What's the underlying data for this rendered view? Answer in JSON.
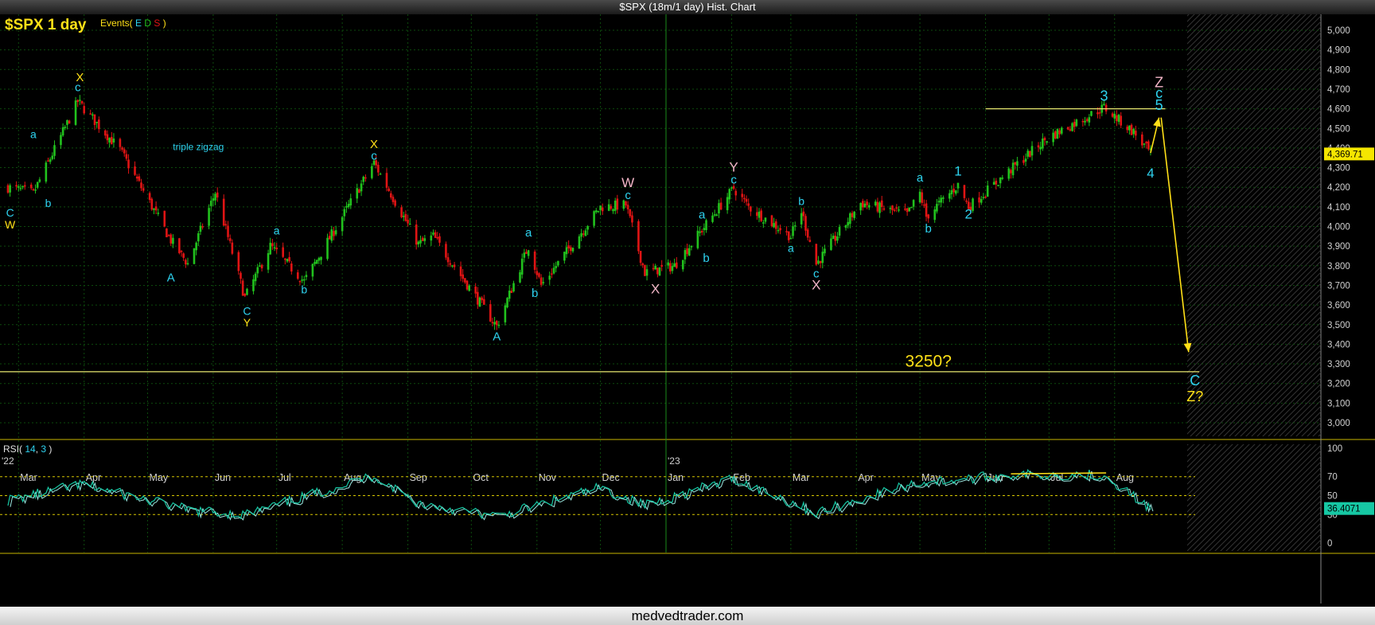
{
  "window": {
    "title": "$SPX (18m/1 day) Hist. Chart"
  },
  "footer": {
    "text": "medvedtrader.com"
  },
  "colors": {
    "up": "#21c21d",
    "down": "#e01414",
    "label_cyan": "#2ed3f0",
    "label_yellow": "#ffe017",
    "label_pink": "#f4b6c8",
    "grid": "#0d4a0d",
    "rsi": "#16c8a4"
  },
  "chart_data": [
    {
      "type": "candlestick",
      "symbol": "$SPX 1 day",
      "events_label": "Events(",
      "events_letters": [
        "E",
        "D",
        "S"
      ],
      "events_close": ")",
      "x_tick_labels": [
        "Mar",
        "Apr",
        "May",
        "Jun",
        "Jul",
        "Aug",
        "Sep",
        "Oct",
        "Nov",
        "Dec",
        "Jan",
        "Feb",
        "Mar",
        "Apr",
        "May",
        "Jun",
        "Jul",
        "Aug"
      ],
      "year_labels": [
        "'22",
        "'23"
      ],
      "ylim": [
        3000,
        5000
      ],
      "y_tick_labels": [
        "5,000",
        "4,900",
        "4,800",
        "4,700",
        "4,600",
        "4,500",
        "4,400",
        "4,300",
        "4,200",
        "4,100",
        "4,000",
        "3,900",
        "3,800",
        "3,700",
        "3,600",
        "3,500",
        "3,400",
        "3,300",
        "3,200",
        "3,100",
        "3,000"
      ],
      "last_price": "4,369.71",
      "price_path": [
        [
          "2022-02-24",
          4200
        ],
        [
          "2022-03-08",
          4170
        ],
        [
          "2022-03-29",
          4637
        ],
        [
          "2022-04-18",
          4390
        ],
        [
          "2022-05-12",
          3930
        ],
        [
          "2022-05-20",
          3810
        ],
        [
          "2022-06-02",
          4175
        ],
        [
          "2022-06-16",
          3636
        ],
        [
          "2022-06-28",
          3900
        ],
        [
          "2022-07-14",
          3720
        ],
        [
          "2022-08-16",
          4325
        ],
        [
          "2022-09-06",
          3910
        ],
        [
          "2022-09-13",
          3950
        ],
        [
          "2022-10-13",
          3491
        ],
        [
          "2022-10-28",
          3900
        ],
        [
          "2022-11-03",
          3700
        ],
        [
          "2022-12-01",
          4100
        ],
        [
          "2022-12-13",
          4110
        ],
        [
          "2022-12-22",
          3765
        ],
        [
          "2023-01-05",
          3800
        ],
        [
          "2023-02-02",
          4195
        ],
        [
          "2023-02-09",
          4100
        ],
        [
          "2023-03-01",
          3950
        ],
        [
          "2023-03-06",
          4078
        ],
        [
          "2023-03-13",
          3808
        ],
        [
          "2023-04-03",
          4120
        ],
        [
          "2023-04-25",
          4060
        ],
        [
          "2023-05-01",
          4170
        ],
        [
          "2023-05-04",
          4050
        ],
        [
          "2023-05-19",
          4212
        ],
        [
          "2023-05-24",
          4100
        ],
        [
          "2023-06-30",
          4450
        ],
        [
          "2023-07-27",
          4607
        ],
        [
          "2023-08-10",
          4480
        ],
        [
          "2023-08-18",
          4370
        ]
      ],
      "annotations": [
        {
          "text": "triple zigzag",
          "date": "2022-05-25",
          "price": 4390,
          "color": "cyan",
          "size": 12
        },
        {
          "text": "C",
          "date": "2022-02-25",
          "price": 4050,
          "color": "cyan",
          "size": 14
        },
        {
          "text": "W",
          "date": "2022-02-25",
          "price": 3990,
          "color": "yellow",
          "size": 14
        },
        {
          "text": "a",
          "date": "2022-03-08",
          "price": 4450,
          "color": "cyan",
          "size": 14
        },
        {
          "text": "b",
          "date": "2022-03-15",
          "price": 4100,
          "color": "cyan",
          "size": 14
        },
        {
          "text": "X",
          "date": "2022-03-30",
          "price": 4740,
          "color": "yellow",
          "size": 15
        },
        {
          "text": "c",
          "date": "2022-03-29",
          "price": 4690,
          "color": "cyan",
          "size": 15
        },
        {
          "text": "A",
          "date": "2022-05-12",
          "price": 3720,
          "color": "cyan",
          "size": 15
        },
        {
          "text": "a",
          "date": "2022-07-01",
          "price": 3960,
          "color": "cyan",
          "size": 14
        },
        {
          "text": "C",
          "date": "2022-06-17",
          "price": 3550,
          "color": "cyan",
          "size": 14
        },
        {
          "text": "Y",
          "date": "2022-06-17",
          "price": 3490,
          "color": "yellow",
          "size": 14
        },
        {
          "text": "b",
          "date": "2022-07-14",
          "price": 3660,
          "color": "cyan",
          "size": 14
        },
        {
          "text": "X",
          "date": "2022-08-16",
          "price": 4400,
          "color": "yellow",
          "size": 15
        },
        {
          "text": "c",
          "date": "2022-08-16",
          "price": 4340,
          "color": "cyan",
          "size": 15
        },
        {
          "text": "A",
          "date": "2022-10-13",
          "price": 3420,
          "color": "cyan",
          "size": 15
        },
        {
          "text": "a",
          "date": "2022-10-28",
          "price": 3950,
          "color": "cyan",
          "size": 15
        },
        {
          "text": "b",
          "date": "2022-10-31",
          "price": 3640,
          "color": "cyan",
          "size": 15
        },
        {
          "text": "W",
          "date": "2022-12-14",
          "price": 4200,
          "color": "pink",
          "size": 17
        },
        {
          "text": "c",
          "date": "2022-12-14",
          "price": 4140,
          "color": "cyan",
          "size": 15
        },
        {
          "text": "X",
          "date": "2022-12-27",
          "price": 3660,
          "color": "pink",
          "size": 17
        },
        {
          "text": "a",
          "date": "2023-01-18",
          "price": 4040,
          "color": "cyan",
          "size": 15
        },
        {
          "text": "b",
          "date": "2023-01-20",
          "price": 3820,
          "color": "cyan",
          "size": 15
        },
        {
          "text": "Y",
          "date": "2023-02-02",
          "price": 4280,
          "color": "pink",
          "size": 17
        },
        {
          "text": "c",
          "date": "2023-02-02",
          "price": 4220,
          "color": "cyan",
          "size": 15
        },
        {
          "text": "b",
          "date": "2023-03-06",
          "price": 4110,
          "color": "cyan",
          "size": 14
        },
        {
          "text": "a",
          "date": "2023-03-01",
          "price": 3870,
          "color": "cyan",
          "size": 14
        },
        {
          "text": "c",
          "date": "2023-03-13",
          "price": 3740,
          "color": "cyan",
          "size": 15
        },
        {
          "text": "X",
          "date": "2023-03-13",
          "price": 3680,
          "color": "pink",
          "size": 17
        },
        {
          "text": "a",
          "date": "2023-05-01",
          "price": 4230,
          "color": "cyan",
          "size": 15
        },
        {
          "text": "b",
          "date": "2023-05-05",
          "price": 3970,
          "color": "cyan",
          "size": 15
        },
        {
          "text": "1",
          "date": "2023-05-19",
          "price": 4260,
          "color": "cyan",
          "size": 17
        },
        {
          "text": "2",
          "date": "2023-05-24",
          "price": 4040,
          "color": "cyan",
          "size": 17
        },
        {
          "text": "3",
          "date": "2023-07-27",
          "price": 4640,
          "color": "cyan",
          "size": 18
        },
        {
          "text": "4",
          "date": "2023-08-18",
          "price": 4250,
          "color": "cyan",
          "size": 17
        },
        {
          "text": "Z",
          "date": "2023-08-22",
          "price": 4710,
          "color": "pink",
          "size": 18
        },
        {
          "text": "c",
          "date": "2023-08-22",
          "price": 4655,
          "color": "cyan",
          "size": 18
        },
        {
          "text": "5",
          "date": "2023-08-22",
          "price": 4595,
          "color": "cyan",
          "size": 18
        },
        {
          "text": "3250?",
          "date": "2023-05-05",
          "price": 3285,
          "color": "yellow",
          "size": 21
        },
        {
          "text": "C",
          "date": "2023-09-08",
          "price": 3190,
          "color": "cyan",
          "size": 18
        },
        {
          "text": "Z?",
          "date": "2023-09-08",
          "price": 3110,
          "color": "yellow",
          "size": 18
        }
      ],
      "horizontal_lines": [
        {
          "price": 3260,
          "from": "2022-02-20",
          "to": "2023-09-10"
        },
        {
          "price": 4600,
          "from": "2023-06-01",
          "to": "2023-08-25"
        }
      ],
      "arrows": [
        {
          "from_date": "2023-08-18",
          "from_price": 4375,
          "to_date": "2023-08-22",
          "to_price": 4555
        },
        {
          "from_date": "2023-08-23",
          "from_price": 4555,
          "to_date": "2023-09-05",
          "to_price": 3360
        }
      ]
    },
    {
      "type": "line",
      "indicator": "RSI(",
      "params": [
        "14",
        "3"
      ],
      "ylim": [
        0,
        100
      ],
      "y_tick_labels": [
        "100",
        "70",
        "50",
        "30",
        "0"
      ],
      "reference_lines": [
        70,
        50,
        30
      ],
      "last_value": "36.4071",
      "rsi_path": [
        [
          "2022-02-24",
          45
        ],
        [
          "2022-03-31",
          62
        ],
        [
          "2022-05-20",
          35
        ],
        [
          "2022-06-16",
          30
        ],
        [
          "2022-08-16",
          71
        ],
        [
          "2022-09-06",
          42
        ],
        [
          "2022-10-13",
          28
        ],
        [
          "2022-11-30",
          58
        ],
        [
          "2022-12-22",
          40
        ],
        [
          "2023-02-02",
          68
        ],
        [
          "2023-03-13",
          32
        ],
        [
          "2023-04-28",
          63
        ],
        [
          "2023-06-13",
          72
        ],
        [
          "2023-07-27",
          72
        ],
        [
          "2023-08-18",
          36
        ]
      ],
      "divergence_line": {
        "from": "2023-06-13",
        "from_value": 73,
        "to": "2023-07-28",
        "to_value": 74
      }
    }
  ]
}
